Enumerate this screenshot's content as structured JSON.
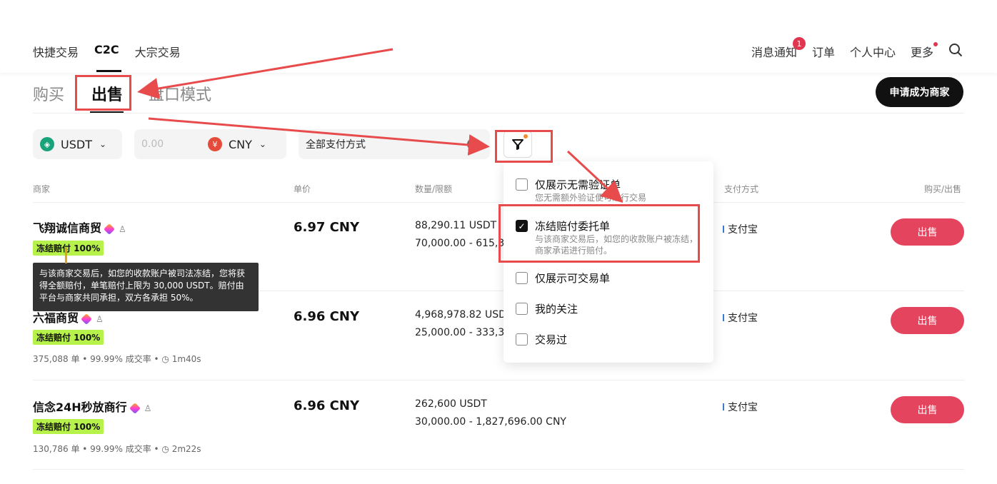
{
  "nav": {
    "left": [
      {
        "label": "快捷交易"
      },
      {
        "label": "C2C"
      },
      {
        "label": "大宗交易"
      }
    ],
    "right": {
      "messages": "消息通知",
      "messages_badge": "1",
      "orders": "订单",
      "profile": "个人中心",
      "more": "更多"
    }
  },
  "tabs": {
    "buy": "购买",
    "sell": "出售",
    "book": "盘口模式"
  },
  "merchant_button": "申请成为商家",
  "filters": {
    "coin": "USDT",
    "amount_placeholder": "0.00",
    "fiat": "CNY",
    "payment": "全部支付方式"
  },
  "columns": {
    "merchant": "商家",
    "price": "单价",
    "qty": "数量/限额",
    "payment": "支付方式",
    "action": "购买/出售"
  },
  "rows": [
    {
      "name": "飞翔诚信商贸",
      "tag": "冻结赔付 100%",
      "stats": "",
      "price": "6.97 CNY",
      "qty": "88,290.11 USDT",
      "limit": "70,000.00 - 615,35",
      "payment": "支付宝",
      "action": "出售"
    },
    {
      "name": "六福商贸",
      "tag": "冻结赔付 100%",
      "stats": "375,088 单 • 99.99% 成交率 • ◷ 1m40s",
      "price": "6.96 CNY",
      "qty": "4,968,978.82 USD",
      "limit": "25,000.00 - 333,33",
      "payment": "支付宝",
      "action": "出售"
    },
    {
      "name": "信念24H秒放商行",
      "tag": "冻结赔付 100%",
      "stats": "130,786 单 • 99.99% 成交率 • ◷ 2m22s",
      "price": "6.96 CNY",
      "qty": "262,600 USDT",
      "limit": "30,000.00 - 1,827,696.00 CNY",
      "payment": "支付宝",
      "action": "出售"
    }
  ],
  "tooltip": "与该商家交易后，如您的收款账户被司法冻结，您将获得全额赔付，单笔赔付上限为 30,000 USDT。赔付由平台与商家共同承担，双方各承担 50%。",
  "dropdown": [
    {
      "title": "仅展示无需验证单",
      "sub": "您无需额外验证便可进行交易",
      "checked": false
    },
    {
      "title": "冻结赔付委托单",
      "sub": "与该商家交易后，如您的收款账户被冻结，商家承诺进行赔付。",
      "checked": true
    },
    {
      "title": "仅展示可交易单",
      "sub": "",
      "checked": false
    },
    {
      "title": "我的关注",
      "sub": "",
      "checked": false
    },
    {
      "title": "交易过",
      "sub": "",
      "checked": false
    }
  ],
  "colors": {
    "accent": "#e4445e",
    "tag": "#b6f24a",
    "annotation": "#e84b4b"
  }
}
